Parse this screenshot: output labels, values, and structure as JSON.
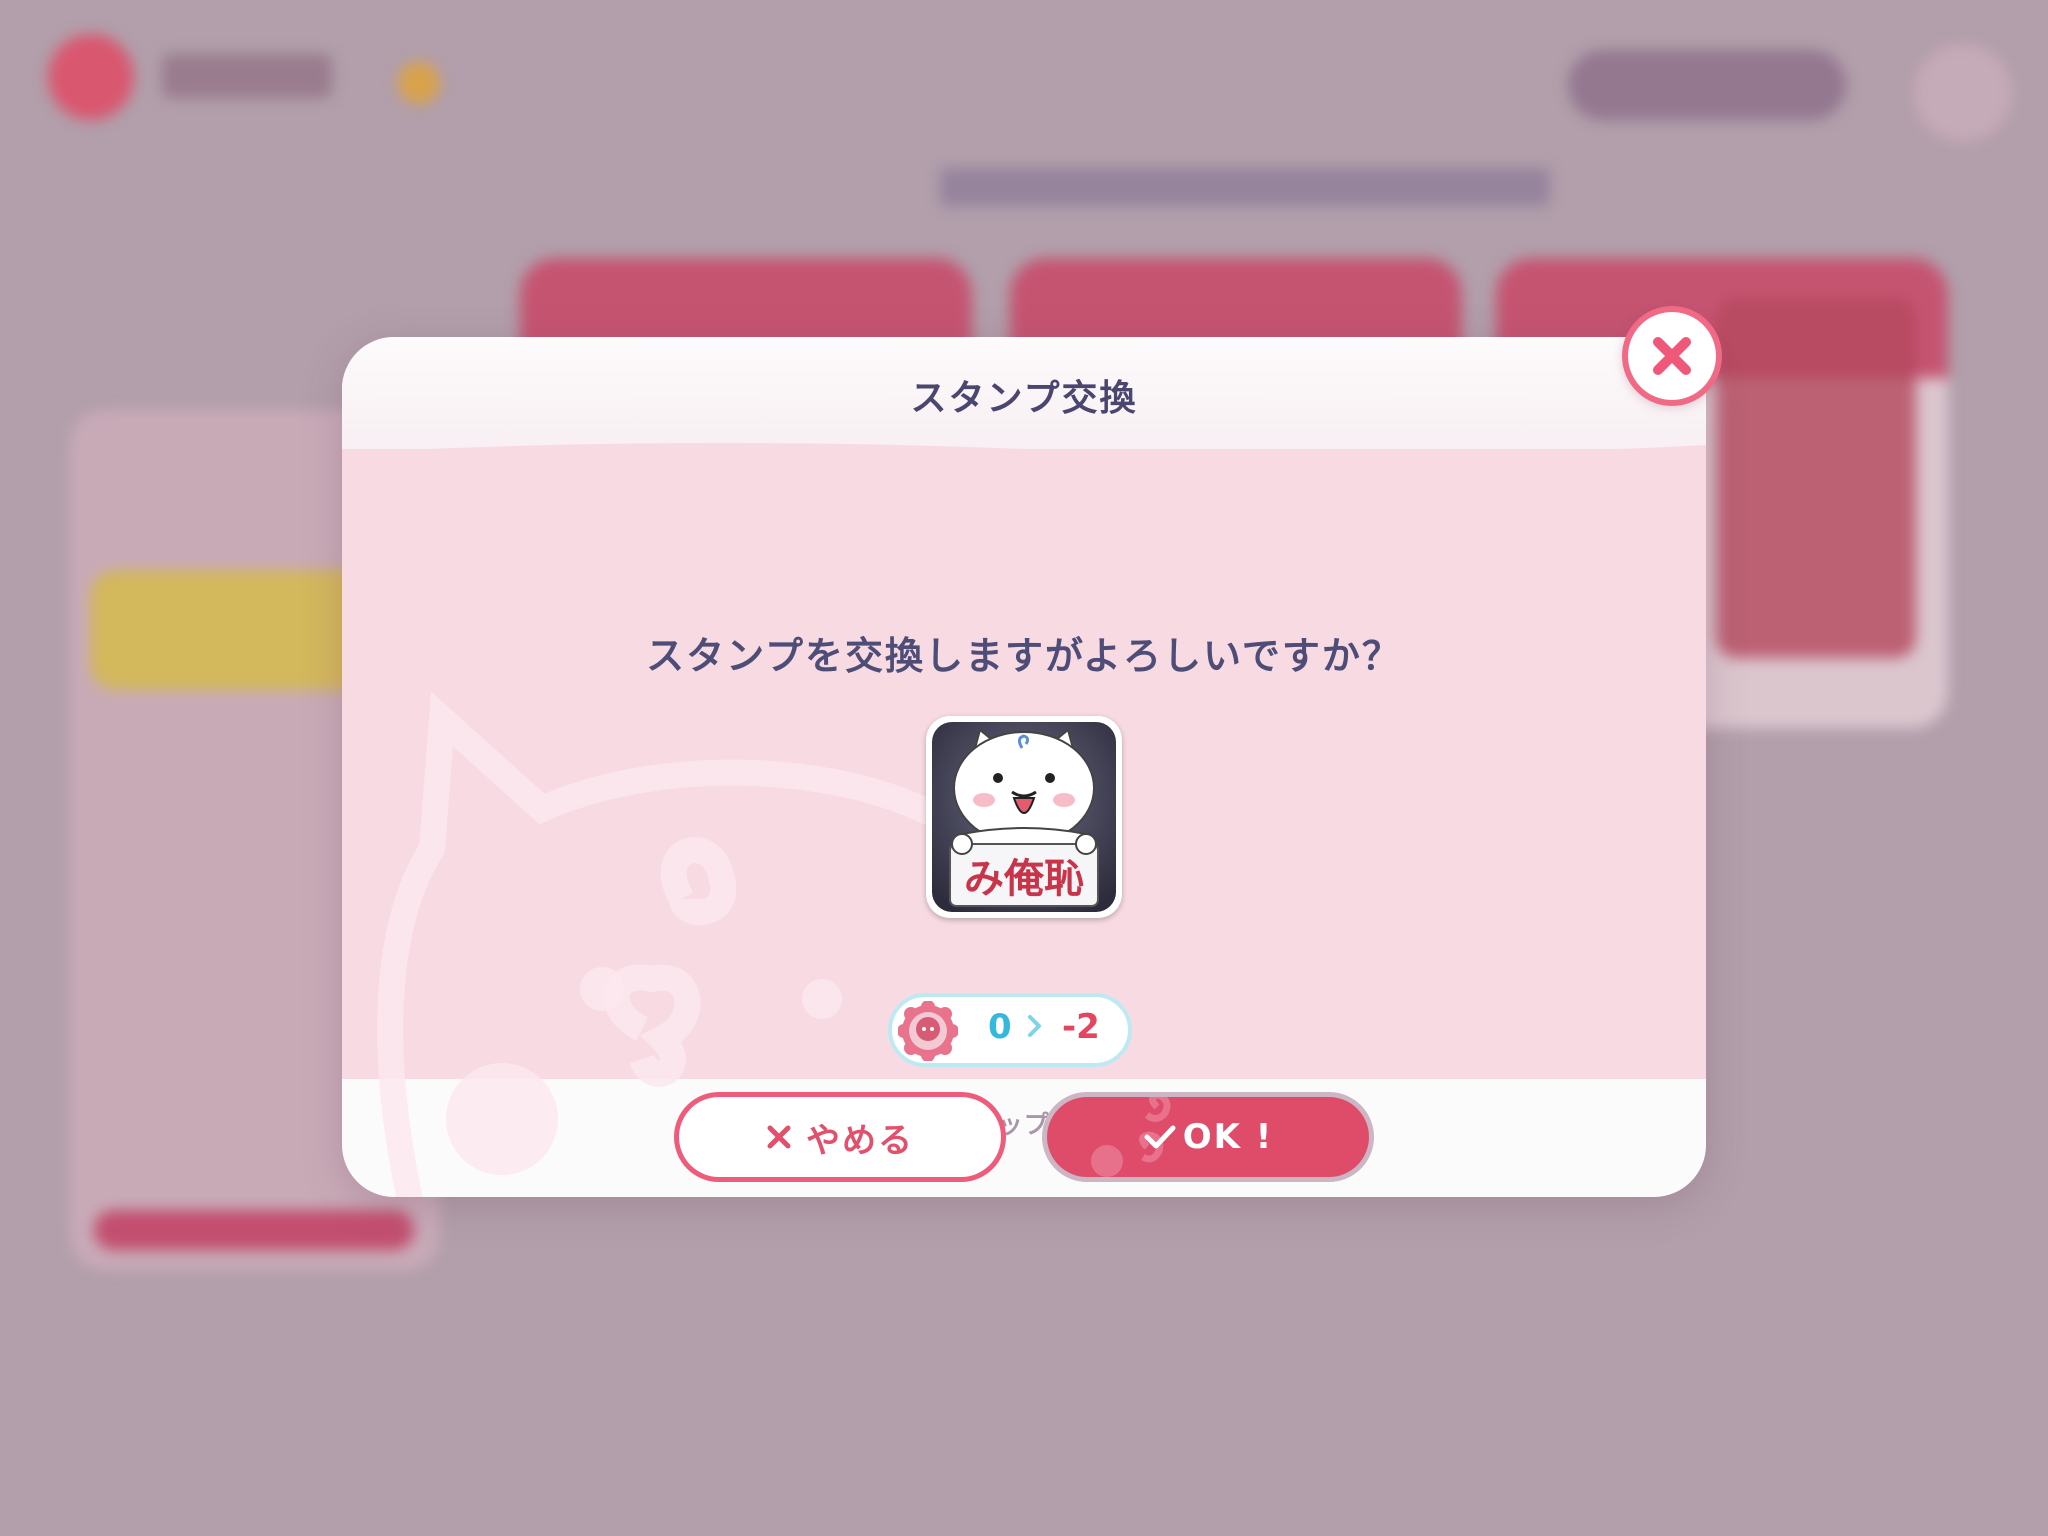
{
  "dialog": {
    "title": "スタンプ交換",
    "question": "スタンプを交換しますがよろしいですか？",
    "stamp": {
      "icon": "white-cat-holding-sign-stamp",
      "sign_text": "み俺恥"
    },
    "cost": {
      "icon": "member-coin-icon",
      "from": "0",
      "to": "-2"
    },
    "note": "交換特典はメンバーシップ解約後も使用できます",
    "cancel_label": "やめる",
    "ok_label": "OK !"
  },
  "colors": {
    "accent": "#de4c6a",
    "title_text": "#4a4670",
    "cost_from": "#35b8de",
    "cost_to": "#e5455e"
  }
}
